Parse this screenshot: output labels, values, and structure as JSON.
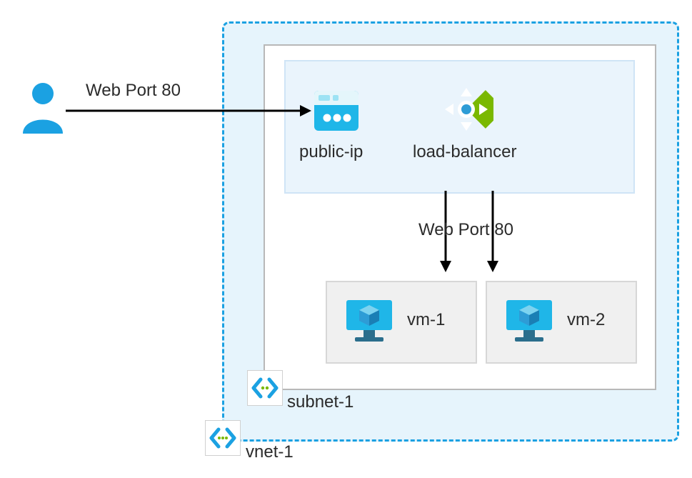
{
  "labels": {
    "arrow_top": "Web Port 80",
    "public_ip": "public-ip",
    "load_balancer": "load-balancer",
    "arrow_mid": "Web Port 80",
    "vm1": "vm-1",
    "vm2": "vm-2",
    "subnet": "subnet-1",
    "vnet": "vnet-1"
  },
  "colors": {
    "azure_blue": "#1ba1e2",
    "vnet_bg": "#e6f4fc",
    "lb_green": "#7ab800",
    "vm_cube": "#2e9cd6",
    "gray_fill": "#f0f0f0",
    "gray_border": "#b8b8b8"
  }
}
